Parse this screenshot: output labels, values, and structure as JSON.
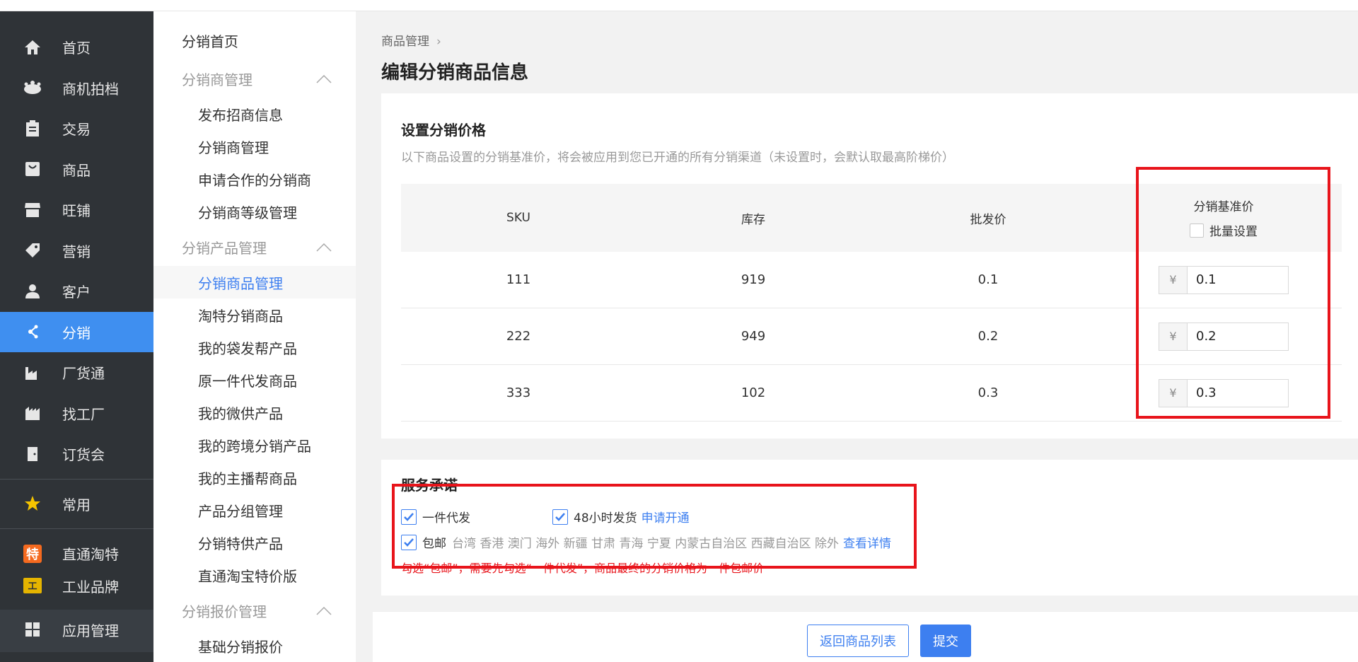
{
  "leftnav": {
    "items": [
      {
        "label": "首页",
        "icon": "home-icon"
      },
      {
        "label": "商机拍档",
        "icon": "crown-icon"
      },
      {
        "label": "交易",
        "icon": "clipboard-icon"
      },
      {
        "label": "商品",
        "icon": "bag-icon"
      },
      {
        "label": "旺铺",
        "icon": "store-icon"
      },
      {
        "label": "营销",
        "icon": "tag-icon"
      },
      {
        "label": "客户",
        "icon": "person-icon"
      },
      {
        "label": "分销",
        "icon": "distribution-icon"
      },
      {
        "label": "厂货通",
        "icon": "factory-icon"
      },
      {
        "label": "找工厂",
        "icon": "factory2-icon"
      },
      {
        "label": "订货会",
        "icon": "door-icon"
      }
    ],
    "common": "常用",
    "extra": [
      {
        "label": "直通淘特",
        "badge": "特"
      },
      {
        "label": "工业品牌",
        "badge": "工"
      }
    ],
    "app_manage": "应用管理",
    "active_color": "#3f8ff0"
  },
  "subnav": {
    "top": "分销首页",
    "groups": [
      {
        "label": "分销商管理",
        "items": [
          "发布招商信息",
          "分销商管理",
          "申请合作的分销商",
          "分销商等级管理"
        ]
      },
      {
        "label": "分销产品管理",
        "items": [
          "分销商品管理",
          "淘特分销商品",
          "我的袋发帮产品",
          "原一件代发商品",
          "我的微供产品",
          "我的跨境分销产品",
          "我的主播帮商品",
          "产品分组管理",
          "分销特供产品",
          "直通淘宝特价版"
        ]
      },
      {
        "label": "分销报价管理",
        "items": [
          "基础分销报价"
        ]
      }
    ]
  },
  "breadcrumb": {
    "item": "商品管理",
    "sep": "›"
  },
  "page_title": "编辑分销商品信息",
  "pricing": {
    "title": "设置分销价格",
    "desc": "以下商品设置的分销基准价，将会被应用到您已开通的所有分销渠道（未设置时，会默认取最高阶梯价）",
    "columns": [
      "SKU",
      "库存",
      "批发价",
      "分销基准价"
    ],
    "batch_label": "批量设置",
    "currency": "¥",
    "rows": [
      {
        "sku": "111",
        "stock": "919",
        "wholesale": "0.1",
        "base": "0.1"
      },
      {
        "sku": "222",
        "stock": "949",
        "wholesale": "0.2",
        "base": "0.2"
      },
      {
        "sku": "333",
        "stock": "102",
        "wholesale": "0.3",
        "base": "0.3"
      }
    ]
  },
  "service": {
    "title": "服务承诺",
    "dropship": "一件代发",
    "ship48": "48小时发货",
    "apply": "申请开通",
    "free_ship": "包邮",
    "exclude_regions": "台湾 香港 澳门 海外 新疆 甘肃 青海 宁夏 内蒙古自治区 西藏自治区 除外",
    "details": "查看详情",
    "warning": "勾选“包邮”，需要先勾选“一件代发”，商品最终的分销价格为一件包邮价"
  },
  "footer": {
    "back": "返回商品列表",
    "submit": "提交"
  },
  "colors": {
    "accent": "#3d7ff0",
    "highlight": "#e8141b"
  }
}
